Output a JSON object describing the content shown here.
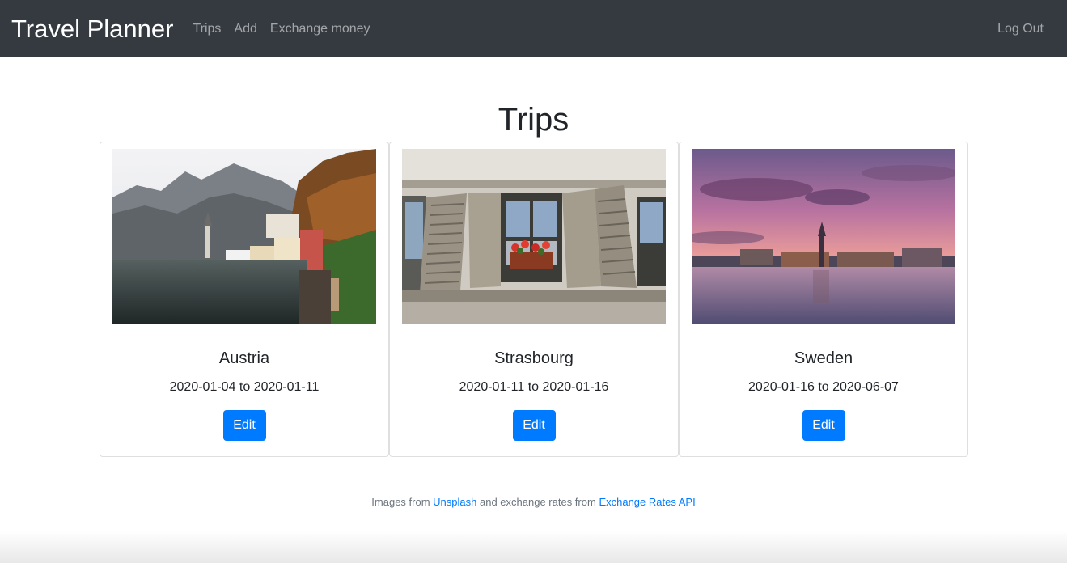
{
  "navbar": {
    "brand": "Travel Planner",
    "links": [
      "Trips",
      "Add",
      "Exchange money"
    ],
    "logout": "Log Out"
  },
  "page_title": "Trips",
  "trips": [
    {
      "name": "Austria",
      "dates": "2020-01-04 to 2020-01-11",
      "edit_label": "Edit",
      "image": "lakeside-village-mountains-photo"
    },
    {
      "name": "Strasbourg",
      "dates": "2020-01-11 to 2020-01-16",
      "edit_label": "Edit",
      "image": "shuttered-windows-flowerbox-photo"
    },
    {
      "name": "Sweden",
      "dates": "2020-01-16 to 2020-06-07",
      "edit_label": "Edit",
      "image": "sunset-city-waterfront-photo"
    }
  ],
  "footer": {
    "prefix": "Images from",
    "link1": "Unsplash",
    "middle": "and exchange rates from",
    "link2": "Exchange Rates API"
  },
  "colors": {
    "navbar_bg": "#343a40",
    "primary": "#007bff"
  }
}
